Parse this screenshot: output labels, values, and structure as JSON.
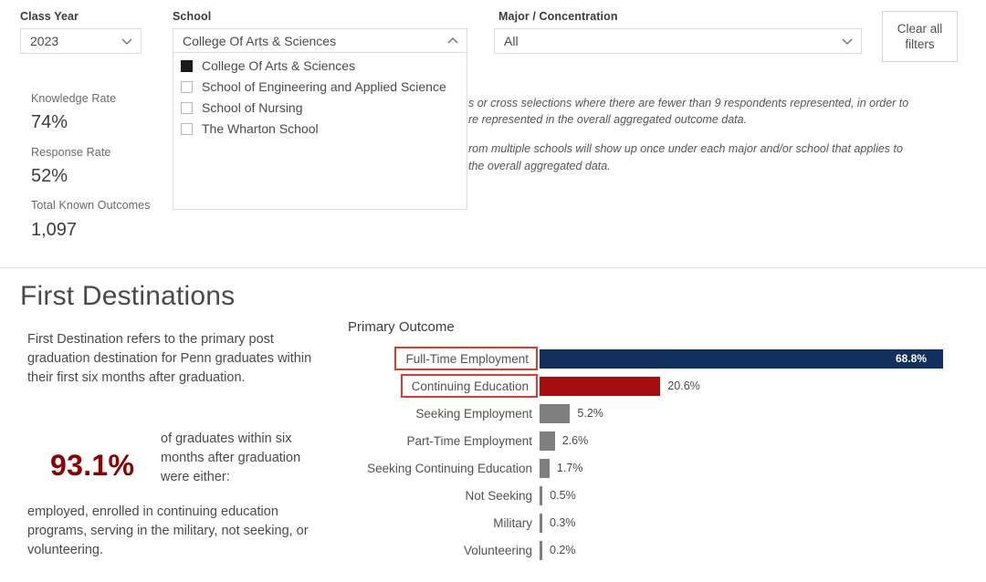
{
  "filters": {
    "class_year": {
      "label": "Class Year",
      "value": "2023",
      "icon": "chevron-down-icon"
    },
    "school": {
      "label": "School",
      "value": "College Of Arts & Sciences",
      "icon": "chevron-up-icon",
      "options": [
        {
          "label": "College Of Arts & Sciences",
          "checked": true
        },
        {
          "label": "School of Engineering and Applied Science",
          "checked": false
        },
        {
          "label": "School of Nursing",
          "checked": false
        },
        {
          "label": "The Wharton School",
          "checked": false
        }
      ]
    },
    "major": {
      "label": "Major / Concentration",
      "value": "All",
      "icon": "chevron-down-icon"
    },
    "clear_all": "Clear all\nfilters"
  },
  "stats": [
    {
      "label": "Knowledge Rate",
      "value": "74%"
    },
    {
      "label": "Response Rate",
      "value": "52%"
    },
    {
      "label": "Total Known Outcomes",
      "value": "1,097"
    }
  ],
  "disclaimer": {
    "line1": "s or cross selections where there are fewer than 9 respondents represented, in order to",
    "line2": "re represented in the overall aggregated outcome data.",
    "line3": "rom multiple schools will show up once under each major and/or school that applies to",
    "line4": "the overall aggregated data."
  },
  "section": {
    "title": "First Destinations",
    "intro": "First Destination refers to the primary post graduation destination for Penn graduates within their first six months after graduation.",
    "headline_pct": "93.1%",
    "headline_text": "of graduates within six months after graduation were either:",
    "footer": "employed, enrolled in continuing education programs, serving in the military, not seeking, or volunteering."
  },
  "chart_data": {
    "type": "bar",
    "title": "Primary Outcome",
    "xlabel": "",
    "ylabel": "",
    "orientation": "horizontal",
    "grid": false,
    "legend": false,
    "xlim": [
      0,
      68.8
    ],
    "categories": [
      "Full-Time Employment",
      "Continuing Education",
      "Seeking Employment",
      "Part-Time Employment",
      "Seeking Continuing Education",
      "Not Seeking",
      "Military",
      "Volunteering"
    ],
    "values": [
      68.8,
      20.6,
      5.2,
      2.6,
      1.7,
      0.5,
      0.3,
      0.2
    ],
    "labels": [
      "68.8%",
      "20.6%",
      "5.2%",
      "2.6%",
      "1.7%",
      "0.5%",
      "0.3%",
      "0.2%"
    ],
    "colors": [
      "#12305e",
      "#a70d0d",
      "#7f7f7f",
      "#7f7f7f",
      "#7f7f7f",
      "#7f7f7f",
      "#7f7f7f",
      "#7f7f7f"
    ],
    "selected": [
      "Full-Time Employment",
      "Continuing Education"
    ],
    "selection_color": "#e03a2f"
  }
}
